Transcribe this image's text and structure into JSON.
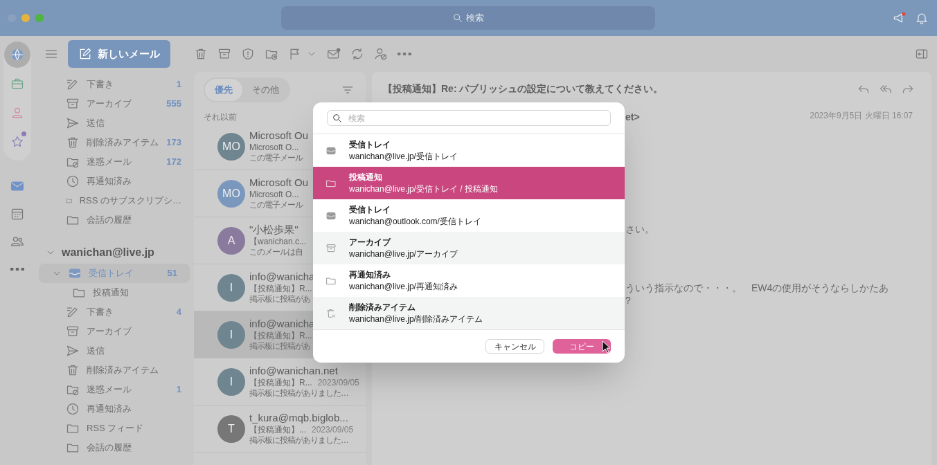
{
  "window": {
    "search_placeholder": "検索"
  },
  "toolbar": {
    "new_mail": "新しいメール"
  },
  "rail": [
    {
      "kind": "globe",
      "selected": true
    },
    {
      "kind": "briefcase",
      "selected": false
    },
    {
      "kind": "person",
      "selected": false
    },
    {
      "kind": "star",
      "selected": false,
      "badge": true
    },
    {
      "kind": "mail",
      "selected": false
    },
    {
      "kind": "calendar",
      "selected": false
    },
    {
      "kind": "people",
      "selected": false
    },
    {
      "kind": "more",
      "selected": false
    }
  ],
  "favorites": [
    {
      "kind": "draft",
      "label": "下書き",
      "count": "1"
    },
    {
      "kind": "archive",
      "label": "アーカイブ",
      "count": "555"
    },
    {
      "kind": "sent",
      "label": "送信"
    },
    {
      "kind": "trash",
      "label": "削除済みアイテム",
      "count": "173"
    },
    {
      "kind": "junk",
      "label": "迷惑メール",
      "count": "172"
    },
    {
      "kind": "snooze",
      "label": "再通知済み"
    },
    {
      "kind": "folder",
      "label": "RSS のサブスクリプシ…"
    },
    {
      "kind": "folder",
      "label": "会話の履歴"
    }
  ],
  "account": {
    "name": "wanichan@live.jp",
    "expanded": true,
    "folders": [
      {
        "kind": "inbox",
        "label": "受信トレイ",
        "count": "51",
        "selected": true,
        "expanded": true,
        "children": [
          {
            "kind": "folder",
            "label": "投稿通知",
            "selected": false
          }
        ]
      },
      {
        "kind": "draft",
        "label": "下書き",
        "count": "4",
        "selected": false
      },
      {
        "kind": "archive",
        "label": "アーカイブ",
        "selected": false
      },
      {
        "kind": "sent",
        "label": "送信",
        "selected": false
      },
      {
        "kind": "trash",
        "label": "削除済みアイテム",
        "selected": false
      },
      {
        "kind": "junk",
        "label": "迷惑メール",
        "count": "1",
        "selected": false
      },
      {
        "kind": "snooze",
        "label": "再通知済み",
        "selected": false
      },
      {
        "kind": "folder",
        "label": "RSS フィード",
        "selected": false
      },
      {
        "kind": "folder",
        "label": "会話の履歴",
        "selected": false
      }
    ]
  },
  "message_list": {
    "tabs": [
      {
        "label": "優先",
        "selected": true
      },
      {
        "label": "その他",
        "selected": false
      }
    ],
    "section": "それ以前",
    "messages": [
      {
        "initials": "MO",
        "color": "#6f8590",
        "sender": "Microsoft Ou",
        "subject": "Microsoft O...",
        "preview": "この電子メール",
        "selected": false
      },
      {
        "initials": "MO",
        "color": "#7a97bd",
        "sender": "Microsoft Ou",
        "subject": "Microsoft O...",
        "preview": "この電子メール",
        "selected": false
      },
      {
        "initials": "A",
        "color": "#8a7a9e",
        "sender": "\"小松歩果\"",
        "subject": "【wanichan.c...",
        "preview": "このメールは自",
        "selected": false
      },
      {
        "initials": "I",
        "color": "#6f8590",
        "sender": "info@wanicha",
        "subject": "【投稿通知】R...",
        "preview": "掲示板に投稿があ",
        "selected": false
      },
      {
        "initials": "I",
        "color": "#6f8590",
        "sender": "info@wanicha",
        "subject": "【投稿通知】R...",
        "preview": "掲示板に投稿があ",
        "selected": true
      },
      {
        "initials": "I",
        "color": "#6f8590",
        "sender": "info@wanichan.net",
        "subject": "【投稿通知】R...",
        "date": "2023/09/05",
        "preview": "掲示板に投稿がありました…",
        "selected": false
      },
      {
        "initials": "T",
        "color": "#777777",
        "sender": "t_kura@mqb.biglob...",
        "subject": "【投稿通知】...",
        "date": "2023/09/05",
        "preview": "掲示板に投稿がありました…",
        "selected": false
      }
    ]
  },
  "reading_pane": {
    "subject": "【投稿通知】Re: パブリッシュの設定について教えてください。",
    "sender_fragment": "et>",
    "date": "2023年9月5日 火曜日 16:07",
    "body_fragments": [
      "さい。",
      "ういう指示なので・・・。　EW4の使用がそうならしかたあ",
      "?"
    ]
  },
  "dialog": {
    "search_placeholder": "検索",
    "folders": [
      {
        "kind": "inbox",
        "name": "受信トレイ",
        "path": "wanichan@live.jp/受信トレイ",
        "selected": false
      },
      {
        "kind": "folder",
        "name": "投稿通知",
        "path": "wanichan@live.jp/受信トレイ / 投稿通知",
        "selected": true
      },
      {
        "kind": "inbox",
        "name": "受信トレイ",
        "path": "wanichan@outlook.com/受信トレイ",
        "selected": false
      },
      {
        "kind": "archive",
        "name": "アーカイブ",
        "path": "wanichan@live.jp/アーカイブ",
        "selected": false
      },
      {
        "kind": "folder",
        "name": "再通知済み",
        "path": "wanichan@live.jp/再通知済み",
        "selected": false
      },
      {
        "kind": "trash",
        "name": "削除済みアイテム",
        "path": "wanichan@live.jp/削除済みアイテム",
        "selected": false
      }
    ],
    "cancel": "キャンセル",
    "copy": "コピー"
  }
}
